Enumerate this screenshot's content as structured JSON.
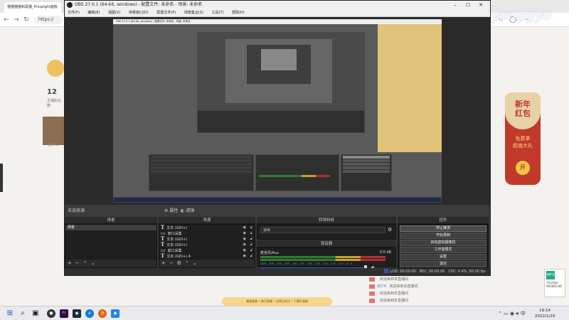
{
  "browser": {
    "tab_title": "猫猫猫猫和黑猫_Prospight面板",
    "address_prefix": "https://",
    "follow_count": "12",
    "follow_label": "主播粉丝数",
    "thumb_caption": "香港 日",
    "redpacket": {
      "title_line1": "新年",
      "title_line2": "红包",
      "sub_line1": "免费拿",
      "sub_line2": "超值大礼",
      "open_label": "开"
    },
    "watermark": "vx群tyaoggyo",
    "media_card": {
      "icon": "MP3",
      "line1": "Thunder -",
      "line2": "083085.NE"
    }
  },
  "obs": {
    "title": "OBS 27.0.1 (64-bit, windows) - 配置文件: 未命名 - 场景: 未命名",
    "menu": [
      "文件(F)",
      "编辑(E)",
      "视图(V)",
      "停靠窗口(D)",
      "配置文件(P)",
      "场景集合(S)",
      "工具(T)",
      "帮助(H)"
    ],
    "mode_bar": {
      "left": "未选择源",
      "props": "属性",
      "filters": "滤镜"
    },
    "scenes": {
      "header": "场景",
      "items": [
        "场景"
      ]
    },
    "sources": {
      "header": "来源",
      "items": [
        "文本 (GDI+)",
        "窗口采集",
        "文本 (GDI+)",
        "文本 (GDI+)",
        "窗口采集",
        "文本 (GDI+) 4"
      ]
    },
    "transitions": {
      "header": "转场特效",
      "selected": "淡出"
    },
    "mixer": {
      "header": "混音器",
      "channel": "麦克风/Aux",
      "value": "0.0 dB",
      "ticks": "-60 -55 -50 -45 -40 -35 -30 -25 -20 -15 -10 -5 0"
    },
    "controls": {
      "header": "控件",
      "buttons": [
        "停止推流",
        "开始录制",
        "启动虚拟摄像机",
        "工作室模式",
        "设置",
        "退出"
      ]
    },
    "status": {
      "live": "LIVE: 00:00:00",
      "rec": "REC: 00:00:00",
      "cpu": "CPU: 0.4%, 60.00 fps"
    },
    "nested_ticker": "感谢观看直播"
  },
  "chat": {
    "lines": [
      {
        "user": "",
        "text": "欢迎来到本直播间"
      },
      {
        "user": "用户B",
        "text": "欢迎来到本直播间"
      },
      {
        "user": "",
        "text": "欢迎来到本直播间"
      },
      {
        "user": "",
        "text": "欢迎来到本直播间"
      }
    ],
    "banner": "感谢观看 • 每日直播 • 记得点关注 • 下播不迷路"
  },
  "taskbar": {
    "icons": [
      "windows-icon",
      "search-icon",
      "task-view-icon",
      "obs-icon",
      "premiere-icon",
      "steam-icon",
      "edge-icon",
      "firefox-icon",
      "app-icon"
    ],
    "time": "19:14",
    "date": "2022/1/29"
  },
  "colors": {
    "accent_blue": "#2a6bd1",
    "obs_bg": "#3b3b3b",
    "redpacket": "#c0392b"
  }
}
